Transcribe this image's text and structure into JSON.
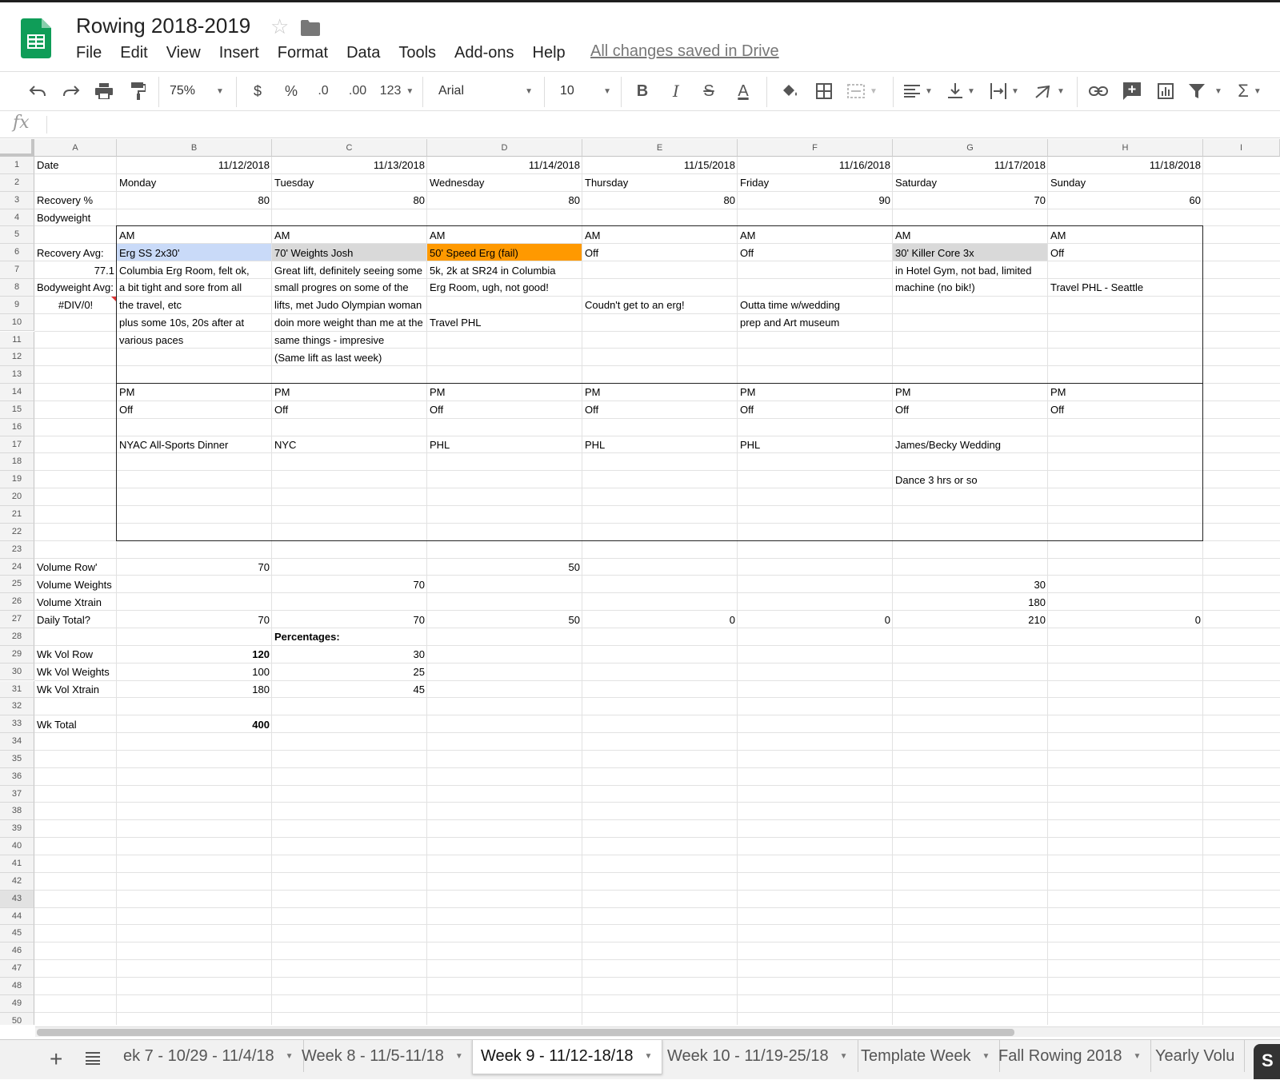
{
  "app": {
    "title": "Rowing 2018-2019",
    "saved_status": "All changes saved in Drive",
    "menu": [
      "File",
      "Edit",
      "View",
      "Insert",
      "Format",
      "Data",
      "Tools",
      "Add-ons",
      "Help"
    ]
  },
  "toolbar": {
    "zoom": "75%",
    "currency": "$",
    "percent": "%",
    "decimal_decrease": ".0",
    "decimal_increase": ".00",
    "number_format": "123",
    "font": "Arial",
    "font_size": "10",
    "bold": "B",
    "italic": "I",
    "strike": "S",
    "text_color": "A"
  },
  "formula_bar": {
    "fx": "fx",
    "value": ""
  },
  "columns": [
    "A",
    "B",
    "C",
    "D",
    "E",
    "F",
    "G",
    "H",
    "I"
  ],
  "selected_row": 43,
  "cells": {
    "r1": [
      "Date",
      "11/12/2018",
      "11/13/2018",
      "11/14/2018",
      "11/15/2018",
      "11/16/2018",
      "11/17/2018",
      "11/18/2018"
    ],
    "r2": [
      "",
      "Monday",
      "Tuesday",
      "Wednesday",
      "Thursday",
      "Friday",
      "Saturday",
      "Sunday"
    ],
    "r3": [
      "Recovery %",
      "80",
      "80",
      "80",
      "80",
      "90",
      "70",
      "60"
    ],
    "r4": [
      "Bodyweight",
      "",
      "",
      "",
      "",
      "",
      "",
      ""
    ],
    "r5": [
      "",
      "AM",
      "AM",
      "AM",
      "AM",
      "AM",
      "AM",
      "AM"
    ],
    "r6": [
      "Recovery Avg:",
      "Erg SS 2x30'",
      "70' Weights Josh",
      "50' Speed Erg (fail)",
      "Off",
      "Off",
      "30' Killer Core 3x",
      "Off"
    ],
    "r7": [
      "77.1",
      "Columbia Erg Room, felt ok,",
      "Great lift, definitely seeing some",
      "5k, 2k at SR24 in Columbia",
      "",
      "",
      "in Hotel Gym, not bad, limited",
      ""
    ],
    "r8": [
      "Bodyweight Avg:",
      "a bit tight and sore from all",
      "small progres on some of the",
      "Erg Room, ugh, not good!",
      "",
      "",
      "machine (no bik!)",
      "Travel PHL - Seattle"
    ],
    "r9": [
      "#DIV/0!",
      "the travel, etc",
      "lifts, met Judo Olympian woman",
      "",
      "Coudn't get to an erg!",
      "Outta time w/wedding",
      "",
      ""
    ],
    "r10": [
      "",
      "plus some 10s, 20s after at",
      "doin more weight than me at the",
      "Travel PHL",
      "",
      "prep and Art museum",
      "",
      ""
    ],
    "r11": [
      "",
      "various paces",
      "same things - impresive",
      "",
      "",
      "",
      "",
      ""
    ],
    "r12": [
      "",
      "",
      "(Same lift as last week)",
      "",
      "",
      "",
      "",
      ""
    ],
    "r14": [
      "",
      "PM",
      "PM",
      "PM",
      "PM",
      "PM",
      "PM",
      "PM"
    ],
    "r15": [
      "",
      "Off",
      "Off",
      "Off",
      "Off",
      "Off",
      "Off",
      "Off"
    ],
    "r17": [
      "",
      "NYAC All-Sports Dinner",
      "NYC",
      "PHL",
      "PHL",
      "PHL",
      "James/Becky Wedding",
      ""
    ],
    "r19": [
      "",
      "",
      "",
      "",
      "",
      "",
      "Dance 3 hrs or so",
      ""
    ],
    "r24": [
      "Volume Row'",
      "70",
      "",
      "50",
      "",
      "",
      "",
      ""
    ],
    "r25": [
      "Volume Weights",
      "",
      "70",
      "",
      "",
      "",
      "30",
      ""
    ],
    "r26": [
      "Volume Xtrain",
      "",
      "",
      "",
      "",
      "",
      "180",
      ""
    ],
    "r27": [
      "Daily Total?",
      "70",
      "70",
      "50",
      "0",
      "0",
      "210",
      "0"
    ],
    "r28": [
      "",
      "",
      "Percentages:",
      "",
      "",
      "",
      "",
      ""
    ],
    "r29": [
      "Wk Vol Row",
      "120",
      "30",
      "",
      "",
      "",
      "",
      ""
    ],
    "r30": [
      "Wk Vol Weights",
      "100",
      "25",
      "",
      "",
      "",
      "",
      ""
    ],
    "r31": [
      "Wk Vol Xtrain",
      "180",
      "45",
      "",
      "",
      "",
      "",
      ""
    ],
    "r33": [
      "Wk Total",
      "400",
      "",
      "",
      "",
      "",
      "",
      ""
    ]
  },
  "highlights": {
    "B6": "#c9daf8",
    "C6": "#d9d9d9",
    "D6": "#ff9900",
    "G6": "#d9d9d9"
  },
  "sheet_tabs": [
    {
      "label": "ek 7 - 10/29 - 11/4/18",
      "active": false
    },
    {
      "label": "Week 8 - 11/5-11/18",
      "active": false
    },
    {
      "label": "Week 9 - 11/12-18/18",
      "active": true
    },
    {
      "label": "Week 10 - 11/19-25/18",
      "active": false
    },
    {
      "label": "Template Week",
      "active": false
    },
    {
      "label": "Fall Rowing 2018",
      "active": false
    },
    {
      "label": "Yearly Volu",
      "active": false
    }
  ],
  "explore_label": "S",
  "colors": {
    "brand_green": "#0f9d58",
    "accent_text": "#222222"
  }
}
